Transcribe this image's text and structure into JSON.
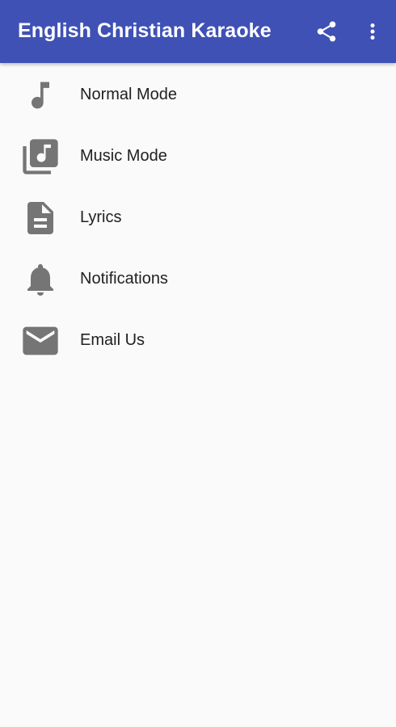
{
  "app_bar": {
    "title": "English Christian Karaoke",
    "background_color": "#3f51b5",
    "actions": [
      {
        "icon": "share-icon"
      },
      {
        "icon": "more-vert-icon"
      }
    ]
  },
  "menu": {
    "items": [
      {
        "label": "Normal Mode",
        "icon": "music-note-icon"
      },
      {
        "label": "Music Mode",
        "icon": "music-library-icon"
      },
      {
        "label": "Lyrics",
        "icon": "document-icon"
      },
      {
        "label": "Notifications",
        "icon": "bell-icon"
      },
      {
        "label": "Email Us",
        "icon": "email-icon"
      }
    ],
    "icon_color": "#757575"
  }
}
